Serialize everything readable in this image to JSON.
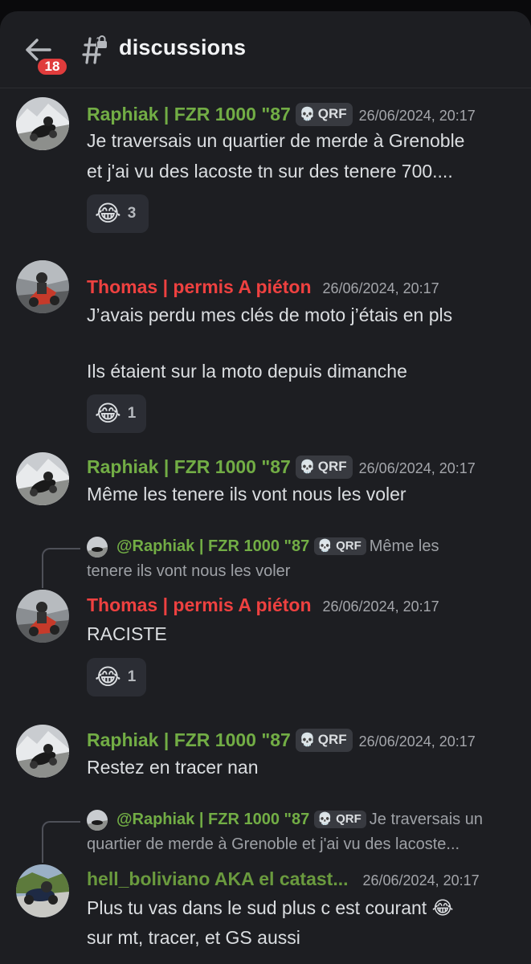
{
  "header": {
    "unread_badge": "18",
    "channel_name": "discussions"
  },
  "messages": [
    {
      "author": "Raphiak | FZR 1000 \"87",
      "tag": "QRF",
      "time": "26/06/2024, 20:17",
      "lines": [
        "Je traversais un quartier de merde à Grenoble",
        "et j'ai vu des lacoste tn sur des tenere 700...."
      ],
      "reaction": {
        "emoji": "😂",
        "count": "3"
      }
    },
    {
      "author": "Thomas | permis A piéton",
      "time": "26/06/2024, 20:17",
      "lines": [
        "J’avais perdu mes clés de moto j’étais en pls",
        "Ils étaient sur la moto depuis dimanche"
      ],
      "reaction": {
        "emoji": "😂",
        "count": "1"
      }
    },
    {
      "author": "Raphiak | FZR 1000 \"87",
      "tag": "QRF",
      "time": "26/06/2024, 20:17",
      "lines": [
        "Même les tenere ils vont nous les voler"
      ]
    },
    {
      "reply": {
        "author": "@Raphiak | FZR 1000 \"87",
        "tag": "QRF",
        "text_line1": "Même les",
        "text_line2": "tenere ils vont nous les voler"
      },
      "author": "Thomas | permis A piéton",
      "time": "26/06/2024, 20:17",
      "lines": [
        "RACISTE"
      ],
      "reaction": {
        "emoji": "😂",
        "count": "1"
      }
    },
    {
      "author": "Raphiak | FZR 1000 \"87",
      "tag": "QRF",
      "time": "26/06/2024, 20:17",
      "lines": [
        "Restez en tracer nan"
      ]
    },
    {
      "reply": {
        "author": "@Raphiak | FZR 1000 \"87",
        "tag": "QRF",
        "text_line1": "Je traversais un",
        "text_line2": "quartier de merde à Grenoble et j'ai vu des lacoste..."
      },
      "author": "hell_boliviano AKA el catast...",
      "time": "26/06/2024, 20:17",
      "lines": [
        "Plus tu vas dans le sud plus c est courant 😂",
        "sur mt, tracer, et GS aussi"
      ]
    }
  ],
  "colors": {
    "background": "#1d1e22",
    "green_role": "#72ad45",
    "red_role": "#ee4140",
    "badge": "#e03c3c"
  }
}
